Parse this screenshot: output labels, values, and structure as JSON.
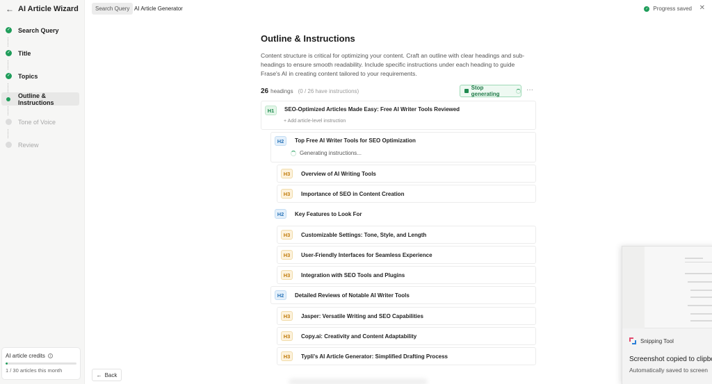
{
  "sidebar": {
    "title": "AI Article Wizard",
    "back_glyph": "←",
    "steps": [
      {
        "label": "Search Query",
        "state": "done"
      },
      {
        "label": "Title",
        "state": "done"
      },
      {
        "label": "Topics",
        "state": "done"
      },
      {
        "label": "Outline & Instructions",
        "state": "current"
      },
      {
        "label": "Tone of Voice",
        "state": "todo"
      },
      {
        "label": "Review",
        "state": "todo"
      }
    ],
    "credits": {
      "title": "AI article credits",
      "used": 1,
      "total": 30,
      "text": "1 / 30 articles this month"
    }
  },
  "topbar": {
    "crumbs": [
      "Search Query",
      "AI Article Generator"
    ],
    "status": "Progress saved",
    "close_glyph": "✕"
  },
  "main": {
    "title": "Outline & Instructions",
    "description": "Content structure is critical for optimizing your content. Craft an outline with clear headings and sub-headings to ensure smooth readability. Include specific instructions under each heading to guide Frase's AI in creating content tailored to your requirements.",
    "heading_count": "26",
    "heading_count_label": "headings",
    "instructions_note": "(0 / 26 have instructions)",
    "stop_button": "Stop generating",
    "more_glyph": "···",
    "add_instruction": "+ Add article-level instruction",
    "generating": "Generating instructions...",
    "outline": [
      {
        "level": "H1",
        "text": "SEO-Optimized Articles Made Easy: Free AI Writer Tools Reviewed"
      },
      {
        "level": "H2",
        "text": "Top Free AI Writer Tools for SEO Optimization"
      },
      {
        "level": "H3",
        "text": "Overview of AI Writing Tools"
      },
      {
        "level": "H3",
        "text": "Importance of SEO in Content Creation"
      },
      {
        "level": "H2",
        "text": "Key Features to Look For"
      },
      {
        "level": "H3",
        "text": "Customizable Settings: Tone, Style, and Length"
      },
      {
        "level": "H3",
        "text": "User-Friendly Interfaces for Seamless Experience"
      },
      {
        "level": "H3",
        "text": "Integration with SEO Tools and Plugins"
      },
      {
        "level": "H2",
        "text": "Detailed Reviews of Notable AI Writer Tools"
      },
      {
        "level": "H3",
        "text": "Jasper: Versatile Writing and SEO Capabilities"
      },
      {
        "level": "H3",
        "text": "Copy.ai: Creativity and Content Adaptability"
      },
      {
        "level": "H3",
        "text": "Typli's AI Article Generator: Simplified Drafting Process"
      }
    ],
    "back_button": "Back",
    "back_glyph": "←"
  },
  "toast": {
    "app": "Snipping Tool",
    "title": "Screenshot copied to clipboa",
    "subtitle": "Automatically saved to screen"
  },
  "colors": {
    "accent_green": "#1f9d5a",
    "h1_tag": "#1f8a50",
    "h2_tag": "#2a74b8",
    "h3_tag": "#c07b0c"
  }
}
